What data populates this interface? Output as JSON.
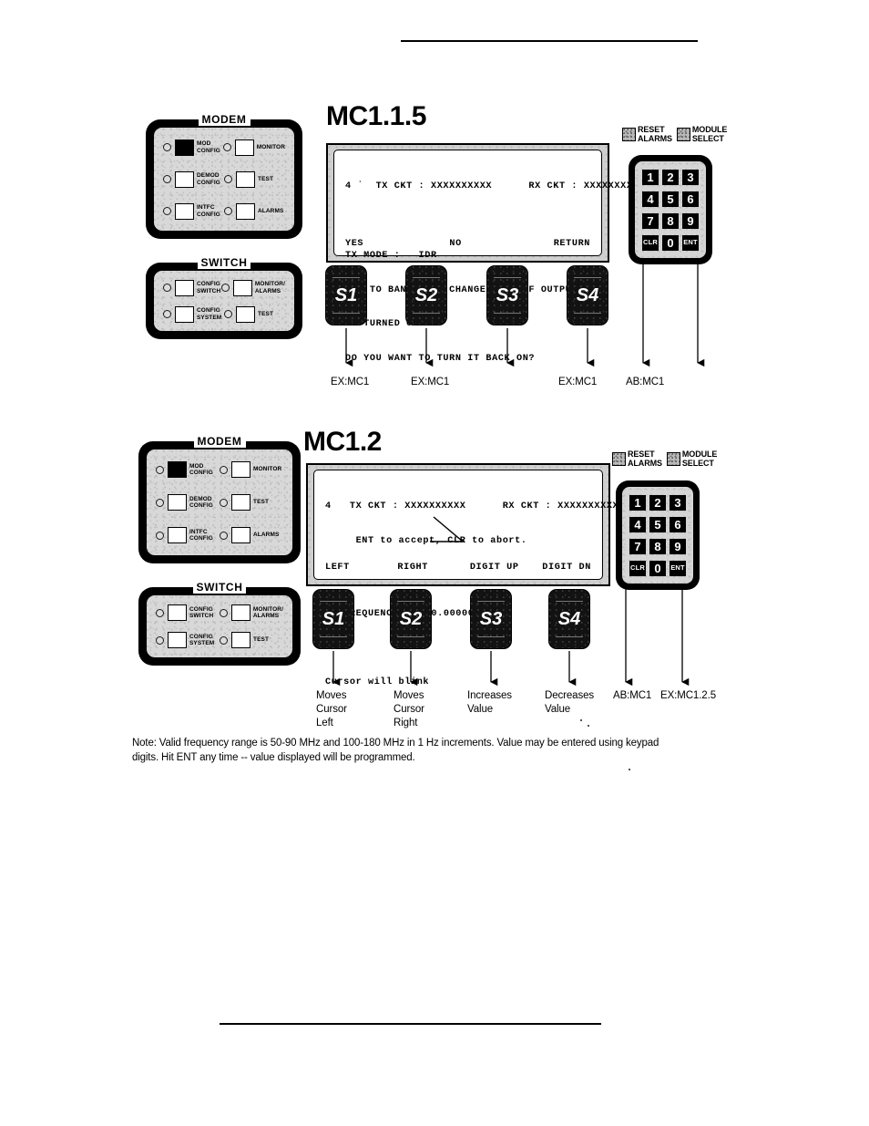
{
  "page": {
    "header_rule": true,
    "footer_rule": true
  },
  "figures": [
    {
      "id": "mc115",
      "heading": "MC1.1.5",
      "modem_panel": {
        "caption": "MODEM",
        "rows": [
          {
            "left": {
              "button_label": "MOD\nCONFIG",
              "filled": true
            },
            "right": {
              "button_label": "MONITOR",
              "filled": false
            }
          },
          {
            "left": {
              "button_label": "DEMOD\nCONFIG",
              "filled": false
            },
            "right": {
              "button_label": "TEST",
              "filled": false
            }
          },
          {
            "left": {
              "button_label": "INTFC\nCONFIG",
              "filled": false
            },
            "right": {
              "button_label": "ALARMS",
              "filled": false
            }
          }
        ]
      },
      "switch_panel": {
        "caption": "SWITCH",
        "rows": [
          {
            "left": {
              "button_label": "CONFIG\nSWITCH",
              "filled": false
            },
            "right": {
              "button_label": "MONITOR/\nALARMS",
              "filled": false
            }
          },
          {
            "left": {
              "button_label": "CONFIG\nSYSTEM",
              "filled": false
            },
            "right": {
              "button_label": "TEST",
              "filled": false
            }
          }
        ]
      },
      "lcd": {
        "line1": "4 ˙  TX CKT : XXXXXXXXXX      RX CKT : XXXXXXXXXX",
        "line2": "",
        "line3": "TX MODE :   IDR",
        "line4": "DUE TO BANDWIDTH CHANGE, THE IF OUTPUT",
        "line5": "IS TURNED OFF",
        "line6": "DO YOU WANT TO TURN IT BACK ON?",
        "softkeys": [
          "YES",
          "NO",
          "RETURN"
        ]
      },
      "softbuttons": [
        "S1",
        "S2",
        "S3",
        "S4"
      ],
      "top_keys": [
        {
          "label": "RESET\nALARMS"
        },
        {
          "label": "MODULE\nSELECT"
        }
      ],
      "keypad": {
        "keys": [
          "1",
          "2",
          "3",
          "4",
          "5",
          "6",
          "7",
          "8",
          "9",
          "CLR",
          "0",
          "ENT"
        ]
      },
      "callouts": [
        {
          "text": "EX:MC1",
          "for": "S1"
        },
        {
          "text": "EX:MC1",
          "for": "S2"
        },
        {
          "text": "",
          "for": "S3"
        },
        {
          "text": "EX:MC1",
          "for": "S4"
        },
        {
          "text": "AB:MC1",
          "for": "CLR"
        },
        {
          "text": "",
          "for": "ENT"
        }
      ]
    },
    {
      "id": "mc12",
      "heading": "MC1.2",
      "modem_panel": {
        "caption": "MODEM",
        "rows": [
          {
            "left": {
              "button_label": "MOD\nCONFIG",
              "filled": true
            },
            "right": {
              "button_label": "MONITOR",
              "filled": false
            }
          },
          {
            "left": {
              "button_label": "DEMOD\nCONFIG",
              "filled": false
            },
            "right": {
              "button_label": "TEST",
              "filled": false
            }
          },
          {
            "left": {
              "button_label": "INTFC\nCONFIG",
              "filled": false
            },
            "right": {
              "button_label": "ALARMS",
              "filled": false
            }
          }
        ]
      },
      "switch_panel": {
        "caption": "SWITCH",
        "rows": [
          {
            "left": {
              "button_label": "CONFIG\nSWITCH",
              "filled": false
            },
            "right": {
              "button_label": "MONITOR/\nALARMS",
              "filled": false
            }
          },
          {
            "left": {
              "button_label": "CONFIG\nSYSTEM",
              "filled": false
            },
            "right": {
              "button_label": "TEST",
              "filled": false
            }
          }
        ]
      },
      "lcd": {
        "line1": "4   TX CKT : XXXXXXXXXX      RX CKT : XXXXXXXXXX",
        "line2": "     ENT to accept, CLR to abort.",
        "line3": "",
        "line4_prefix": "TX FREQUENCY: ",
        "line4_value": "140.000000 MHZ",
        "line5": "",
        "line6": "Cursor will blink",
        "softkeys": [
          "LEFT",
          "RIGHT",
          "DIGIT UP",
          "DIGIT DN"
        ]
      },
      "softbuttons": [
        "S1",
        "S2",
        "S3",
        "S4"
      ],
      "top_keys": [
        {
          "label": "RESET\nALARMS"
        },
        {
          "label": "MODULE\nSELECT"
        }
      ],
      "keypad": {
        "keys": [
          "1",
          "2",
          "3",
          "4",
          "5",
          "6",
          "7",
          "8",
          "9",
          "CLR",
          "0",
          "ENT"
        ]
      },
      "callouts": [
        {
          "text": "Moves\nCursor\nLeft",
          "for": "S1"
        },
        {
          "text": "Moves\nCursor\nRight",
          "for": "S2"
        },
        {
          "text": "Increases\nValue",
          "for": "S3"
        },
        {
          "text": "Decreases\nValue",
          "for": "S4"
        },
        {
          "text": "AB:MC1",
          "for": "CLR"
        },
        {
          "text": "EX:MC1.2.5",
          "for": "ENT"
        }
      ]
    }
  ],
  "note": "Note:  Valid frequency range is 50-90 MHz and 100-180 MHz in 1 Hz increments.  Value may be entered using keypad digits.  Hit ENT any time -- value displayed will be programmed."
}
